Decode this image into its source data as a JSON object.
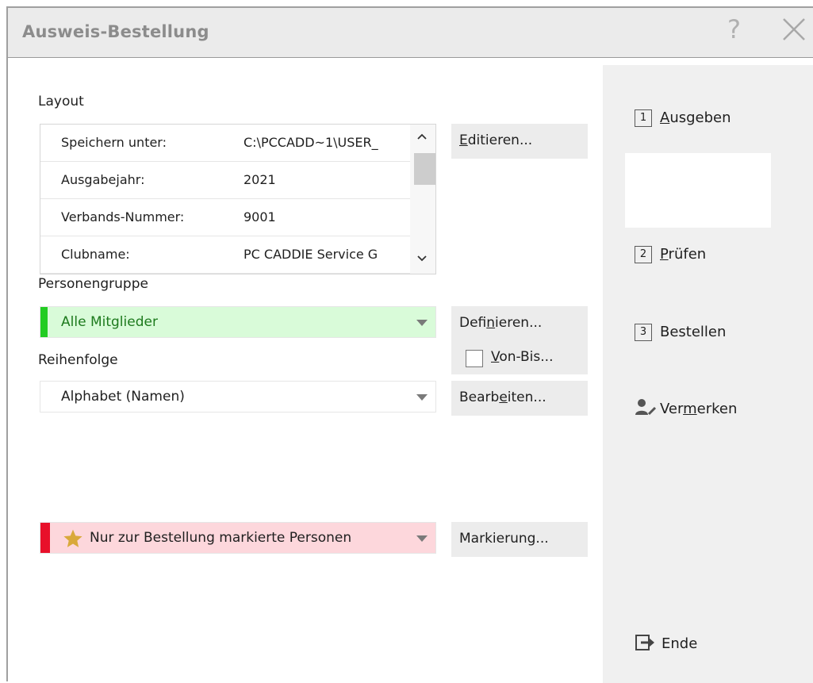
{
  "window": {
    "title": "Ausweis-Bestellung",
    "help_label": "?"
  },
  "layout": {
    "label": "Layout",
    "rows": [
      {
        "key": "Speichern unter:",
        "value": "C:\\PCCADD~1\\USER_"
      },
      {
        "key": "Ausgabejahr:",
        "value": "2021"
      },
      {
        "key": "Verbands-Nummer:",
        "value": "9001"
      },
      {
        "key": "Clubname:",
        "value": "PC CADDIE Service G"
      }
    ],
    "edit_button": {
      "pre": "",
      "ul": "E",
      "post": "ditieren..."
    }
  },
  "personengruppe": {
    "label": "Personengruppe",
    "selected": "Alle Mitglieder",
    "define_button": {
      "pre": "Defi",
      "ul": "n",
      "post": "ieren..."
    },
    "vonbis": {
      "pre": "",
      "ul": "V",
      "post": "on-Bis...",
      "checked": false
    }
  },
  "reihenfolge": {
    "label": "Reihenfolge",
    "selected": "Alphabet (Namen)",
    "edit_button": {
      "pre": "Bearb",
      "ul": "e",
      "post": "iten..."
    }
  },
  "marking": {
    "selected": "Nur zur Bestellung markierte Personen",
    "button": "Markierung..."
  },
  "sidebar": {
    "ausgeben": {
      "num": "1",
      "pre": "",
      "ul": "A",
      "post": "usgeben"
    },
    "pruefen": {
      "num": "2",
      "pre": "",
      "ul": "P",
      "post": "rüfen"
    },
    "bestellen": {
      "num": "3",
      "label": "Bestellen"
    },
    "vermerken": {
      "pre": "Ver",
      "ul": "m",
      "post": "erken"
    },
    "ende": {
      "label": "Ende"
    }
  },
  "colors": {
    "green_accent": "#22cc22",
    "green_bg": "#d9fbd9",
    "red_accent": "#e8102a",
    "red_bg": "#fdd7dc",
    "star": "#d9a93b"
  }
}
